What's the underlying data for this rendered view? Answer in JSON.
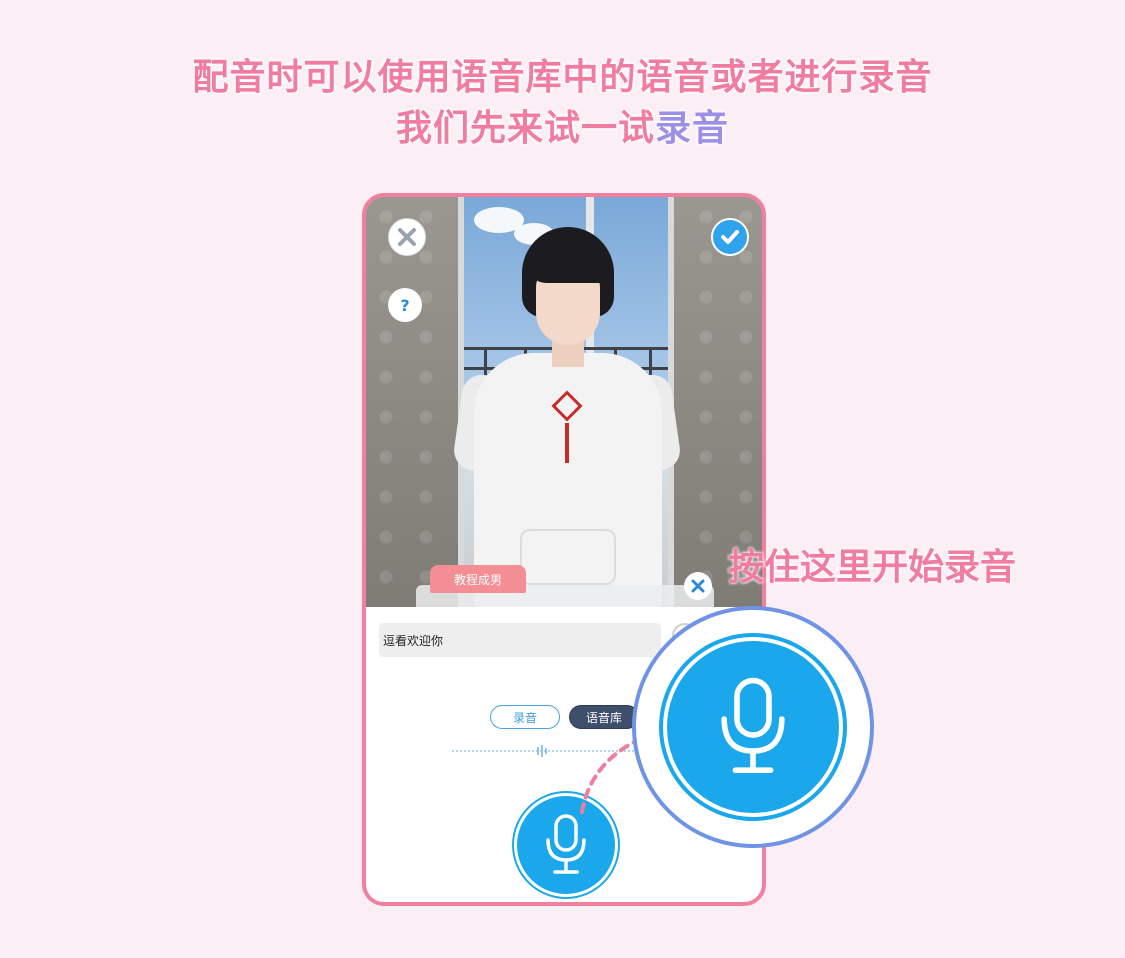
{
  "headline": {
    "line1": "配音时可以使用语音库中的语音或者进行录音",
    "line2_prefix": "我们先来试一试",
    "line2_highlight": "录音"
  },
  "toolbar": {
    "close_icon": "close-icon",
    "help_label": "?",
    "confirm_icon": "check-icon"
  },
  "character": {
    "name_tag": "教程成男"
  },
  "dialog": {
    "text": "逗看欢迎你"
  },
  "modes": {
    "record_label": "录音",
    "library_label": "语音库"
  },
  "callout": {
    "label": "按住这里开始录音"
  },
  "colors": {
    "accent_pink": "#f07ca0",
    "highlight_purple": "#9d8ee8",
    "mic_blue": "#1aa7ec",
    "frame_pink": "#f27f9f",
    "ring_blue": "#6f93e6"
  }
}
